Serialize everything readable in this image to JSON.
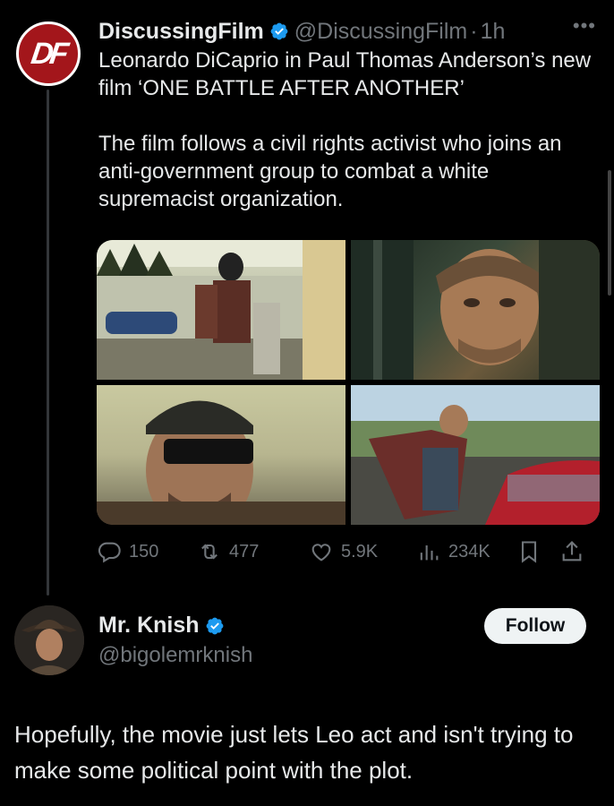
{
  "tweet": {
    "author_name": "DiscussingFilm",
    "handle": "@DiscussingFilm",
    "separator": "·",
    "time": "1h",
    "avatar_text": "DF",
    "more_icon": "more-dots-icon",
    "text": "Leonardo DiCaprio in Paul Thomas Anderson’s new film ‘ONE BATTLE AFTER ANOTHER’\n\nThe film follows a civil rights activist who joins an anti-government group to combat a white supremacist organization.",
    "media_count": 4,
    "stats": {
      "replies": "150",
      "retweets": "477",
      "likes": "5.9K",
      "views": "234K"
    }
  },
  "reply": {
    "author_name": "Mr. Knish",
    "handle": "@bigolemrknish",
    "follow_label": "Follow",
    "text": "Hopefully, the movie just lets Leo act and isn't trying to make some political point with the plot."
  },
  "colors": {
    "background": "#000000",
    "text": "#e7e9ea",
    "muted": "#71767b",
    "verified": "#1d9bf0",
    "brand": "#a3161b"
  }
}
